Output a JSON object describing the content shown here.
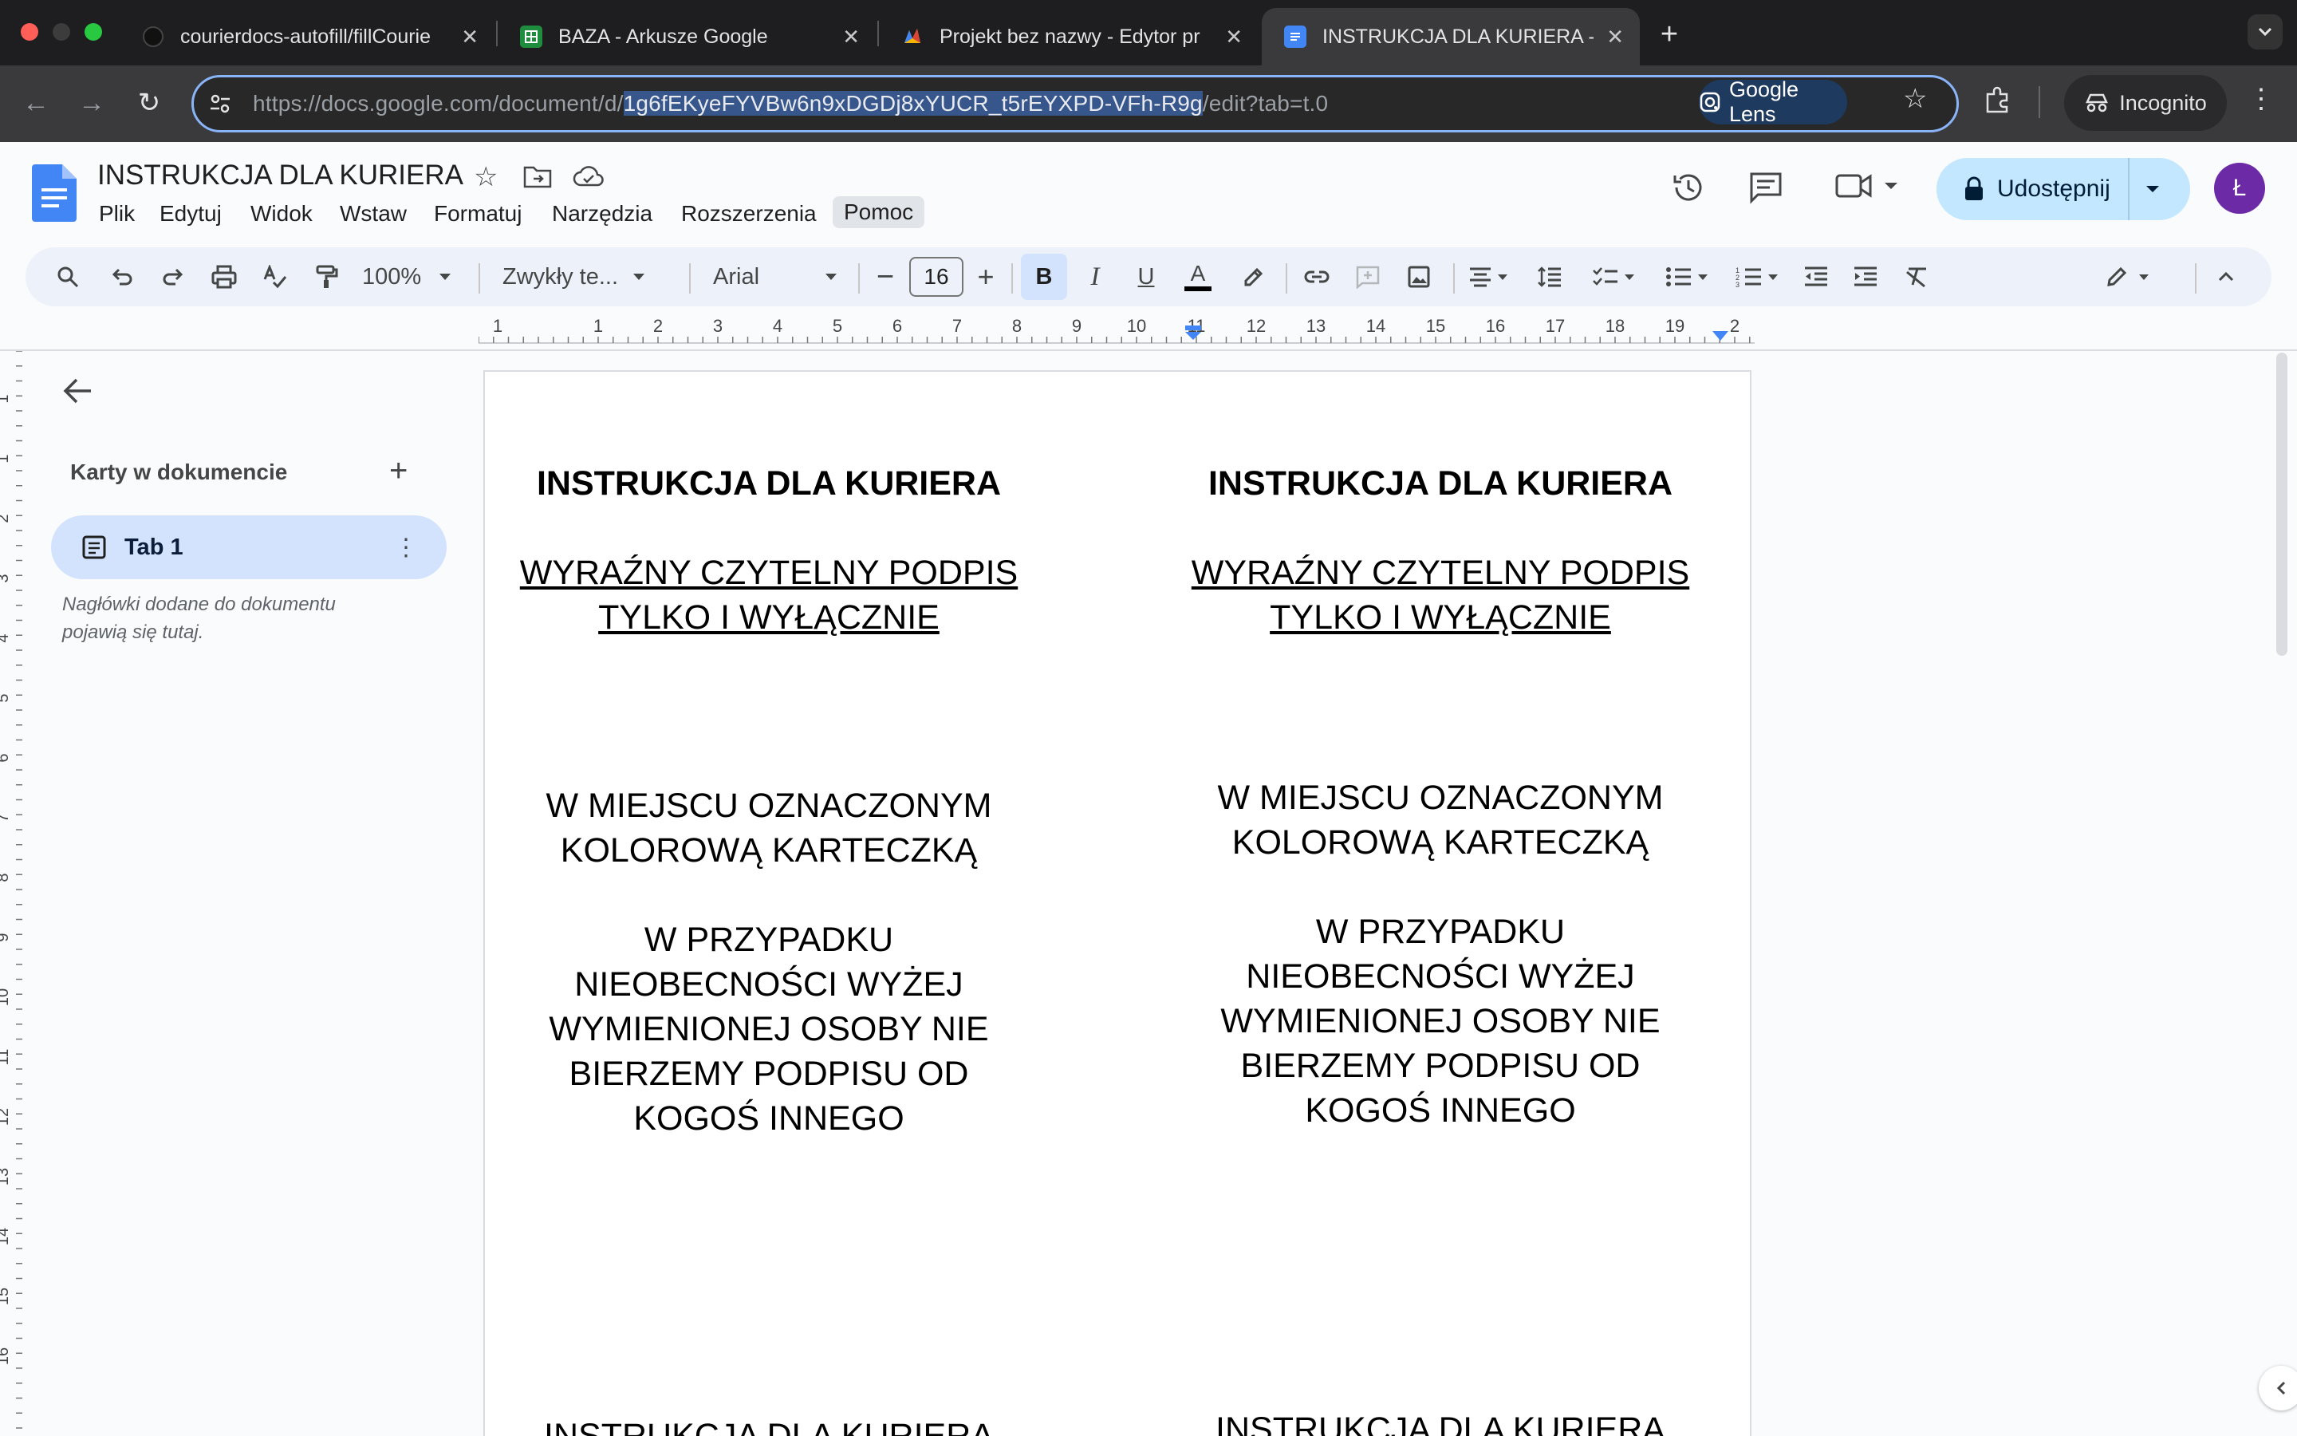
{
  "browser": {
    "tabs": [
      {
        "title": "courierdocs-autofill/fillCourie",
        "icon": "github-icon"
      },
      {
        "title": "BAZA - Arkusze Google",
        "icon": "sheets-icon"
      },
      {
        "title": "Projekt bez nazwy - Edytor pr",
        "icon": "canva-icon"
      },
      {
        "title": "INSTRUKCJA DLA KURIERA -",
        "icon": "docs-icon",
        "active": true
      }
    ],
    "url_prefix": "https://docs.google.com/document/d/",
    "url_id": "1g6fEKyeFYVBw6n9xDGDj8xYUCR_t5rEYXPD-VFh-R9g",
    "url_suffix": "/edit?tab=t.0",
    "lens_label": "Google Lens",
    "incognito_label": "Incognito"
  },
  "docs": {
    "title": "INSTRUKCJA DLA KURIERA",
    "menu": [
      "Plik",
      "Edytuj",
      "Widok",
      "Wstaw",
      "Formatuj",
      "Narzędzia",
      "Rozszerzenia",
      "Pomoc"
    ],
    "share_label": "Udostępnij",
    "avatar_letter": "Ł",
    "toolbar": {
      "zoom": "100%",
      "style": "Zwykły te...",
      "font": "Arial",
      "font_size": "16"
    }
  },
  "ruler": {
    "h_labels": [
      "1",
      "1",
      "2",
      "3",
      "4",
      "5",
      "6",
      "7",
      "8",
      "9",
      "10",
      "11",
      "12",
      "13",
      "14",
      "15",
      "16",
      "17",
      "18",
      "19",
      "2"
    ],
    "v_labels": [
      "1",
      "1",
      "2",
      "3",
      "4",
      "5",
      "6",
      "7",
      "8",
      "9",
      "10",
      "11",
      "12",
      "13",
      "14",
      "15",
      "16"
    ]
  },
  "sidepanel": {
    "heading": "Karty w dokumencie",
    "tab_label": "Tab 1",
    "hint": "Nagłówki dodane do dokumentu pojawią się tutaj."
  },
  "document": {
    "left": {
      "title": "INSTRUKCJA DLA KURIERA",
      "underline1": "WYRAŹNY CZYTELNY PODPIS",
      "underline2": "TYLKO I WYŁĄCZNIE",
      "para1a": "W MIEJSCU OZNACZONYM",
      "para1b": "KOLOROWĄ KARTECZKĄ",
      "para2": [
        "W PRZYPADKU",
        "NIEOBECNOŚCI WYŻEJ",
        "WYMIENIONEJ OSOBY NIE",
        "BIERZEMY PODPISU OD",
        "KOGOŚ INNEGO"
      ],
      "next_title": "INSTRUKCJA DLA KURIERA"
    },
    "right": {
      "title": "INSTRUKCJA DLA KURIERA",
      "underline1": "WYRAŹNY CZYTELNY PODPIS",
      "underline2": "TYLKO I WYŁĄCZNIE",
      "para1a": "W MIEJSCU OZNACZONYM",
      "para1b": "KOLOROWĄ KARTECZKĄ",
      "para2": [
        "W PRZYPADKU",
        "NIEOBECNOŚCI WYŻEJ",
        "WYMIENIONEJ OSOBY NIE",
        "BIERZEMY PODPISU OD",
        "KOGOŚ INNEGO"
      ],
      "next_title": "INSTRUKCJA DLA KURIERA"
    }
  }
}
